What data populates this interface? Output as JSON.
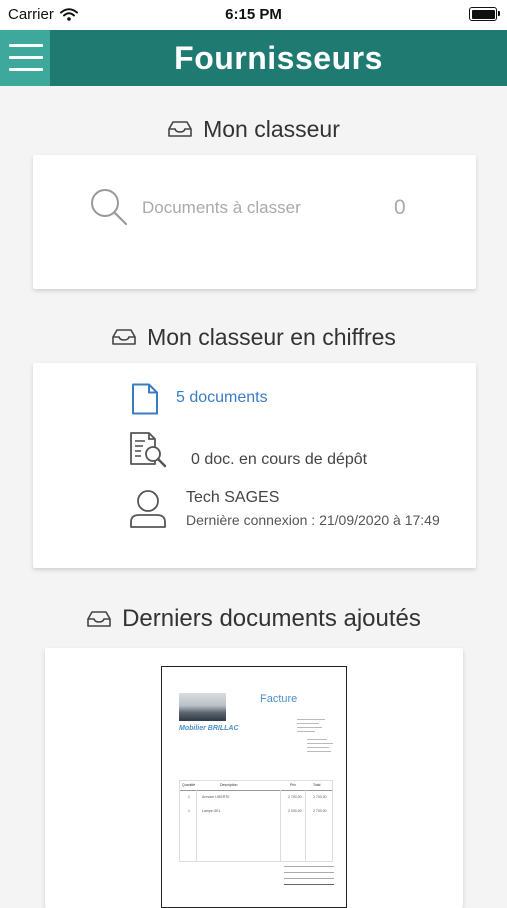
{
  "status": {
    "carrier": "Carrier",
    "time": "6:15 PM"
  },
  "header": {
    "title": "Fournisseurs"
  },
  "classeur": {
    "title": "Mon classeur",
    "search_label": "Documents à classer",
    "count": "0"
  },
  "chiffres": {
    "title": "Mon classeur en chiffres",
    "documents": "5 documents",
    "pending": "0 doc. en cours de dépôt",
    "user_name": "Tech SAGES",
    "last_login": "Dernière connexion : 21/09/2020 à 17:49"
  },
  "recent": {
    "title": "Derniers documents ajoutés",
    "doc": {
      "heading": "Facture",
      "company": "Mobilier BRILLAC",
      "columns": [
        "Quantité",
        "Description",
        "Prix",
        "Total"
      ],
      "rows": [
        [
          "1",
          "Armoire LIBERTE",
          "2 700,00",
          "2 700,00"
        ],
        [
          "1",
          "Lampe GEL",
          "2 000,00",
          "2 700,00"
        ]
      ]
    }
  },
  "colors": {
    "nav_dark": "#1f7a72",
    "nav_light": "#3fa89d",
    "link_blue": "#3a7cc4"
  }
}
